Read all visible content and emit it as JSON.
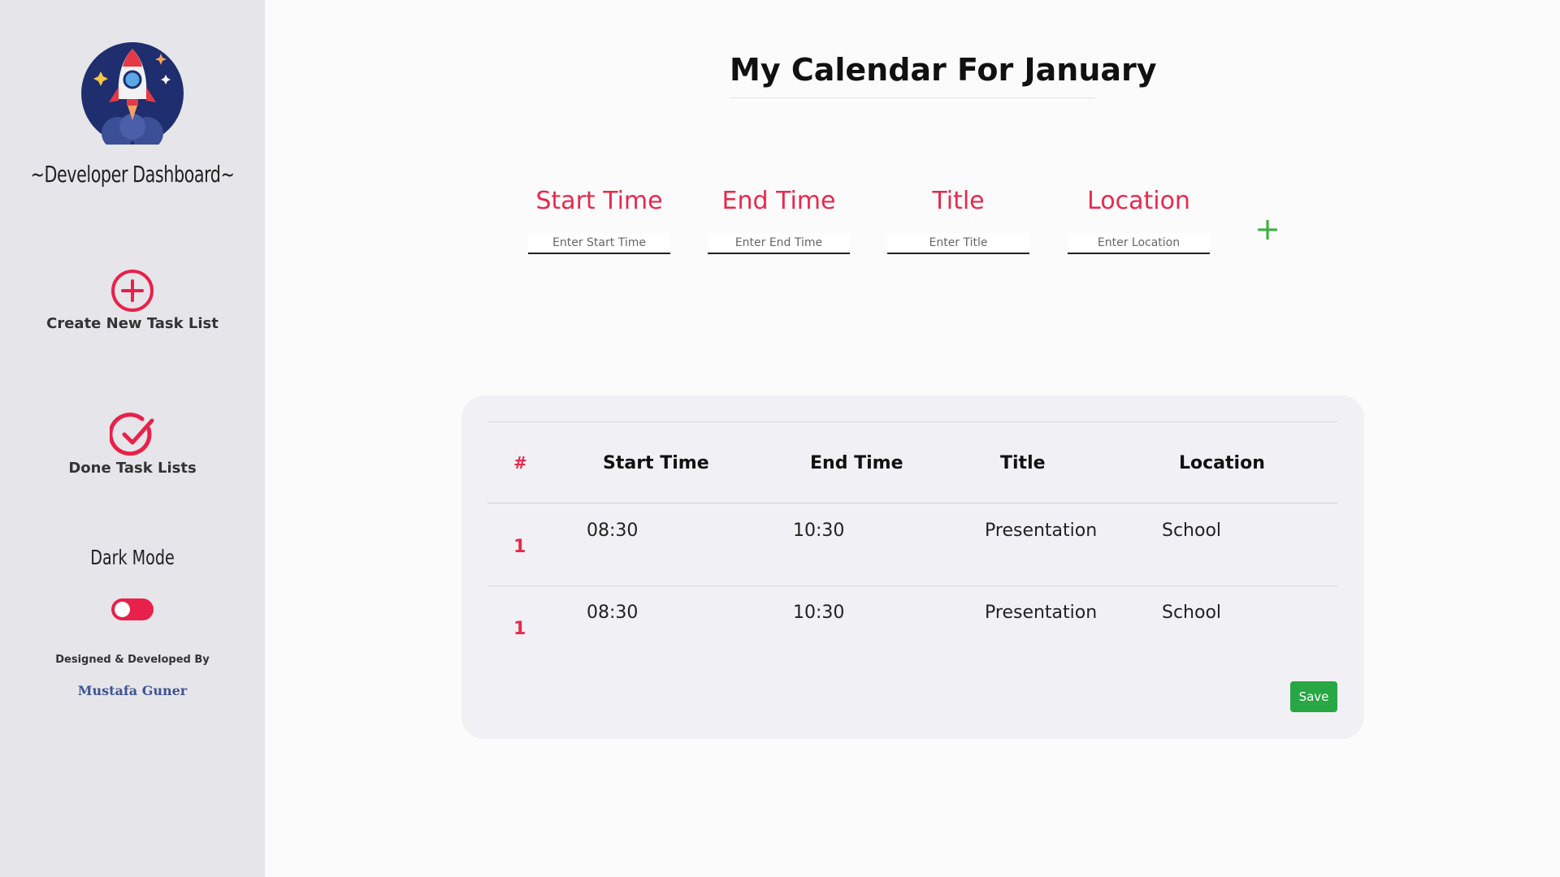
{
  "sidebar": {
    "brand": "~Developer Dashboard~",
    "create_label": "Create New Task List",
    "done_label": "Done Task Lists",
    "dark_mode_label": "Dark Mode",
    "dark_mode_on": false,
    "credit": "Designed & Developed By",
    "author": "Mustafa Guner",
    "accent_color": "#e8214a"
  },
  "main": {
    "title": "My Calendar For January",
    "form": {
      "start": {
        "label": "Start Time",
        "placeholder": "Enter Start Time"
      },
      "end": {
        "label": "End Time",
        "placeholder": "Enter End Time"
      },
      "title": {
        "label": "Title",
        "placeholder": "Enter Title"
      },
      "location": {
        "label": "Location",
        "placeholder": "Enter Location"
      },
      "add_icon": "plus-icon"
    },
    "table": {
      "headers": {
        "num": "#",
        "start": "Start Time",
        "end": "End Time",
        "title": "Title",
        "location": "Location"
      },
      "rows": [
        {
          "num": "1",
          "start": "08:30",
          "end": "10:30",
          "title": "Presentation",
          "location": "School"
        },
        {
          "num": "1",
          "start": "08:30",
          "end": "10:30",
          "title": "Presentation",
          "location": "School"
        }
      ],
      "save_label": "Save"
    }
  }
}
